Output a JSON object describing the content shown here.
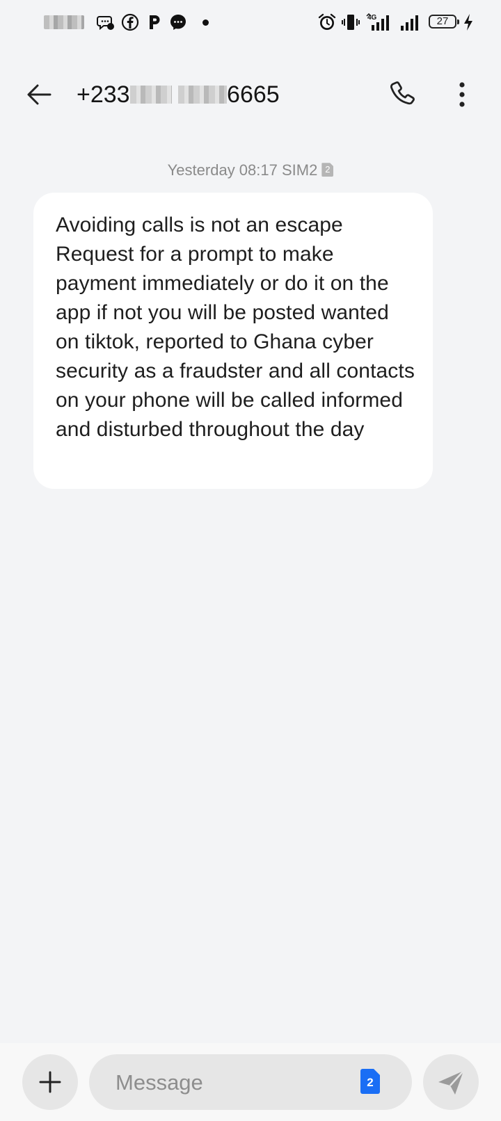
{
  "status_bar": {
    "battery_level": "27",
    "network_type": "4G"
  },
  "header": {
    "title_prefix": "+233",
    "title_suffix": "6665"
  },
  "conversation": {
    "timestamp": "Yesterday 08:17 SIM2",
    "sim_badge": "2",
    "messages": [
      {
        "text": "Avoiding calls is not an escape Request for a prompt to make payment immediately or do it on the app if not you will be posted wanted on tiktok, reported to Ghana cyber security as a fraudster and all contacts on your phone will be called informed and disturbed throughout the day"
      }
    ]
  },
  "composer": {
    "placeholder": "Message",
    "sim_number": "2",
    "accent_color": "#1a6ef5"
  }
}
